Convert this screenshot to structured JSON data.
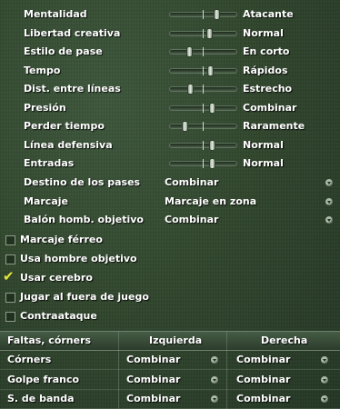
{
  "sliders": [
    {
      "label": "Mentalidad",
      "value": "Atacante",
      "level": 0.72
    },
    {
      "label": "Libertad creativa",
      "value": "Normal",
      "level": 0.6
    },
    {
      "label": "Estilo de pase",
      "value": "En corto",
      "level": 0.28
    },
    {
      "label": "Tempo",
      "value": "Rápidos",
      "level": 0.62
    },
    {
      "label": "Dist. entre líneas",
      "value": "Estrecho",
      "level": 0.3
    },
    {
      "label": "Presión",
      "value": "Combinar",
      "level": 0.64
    },
    {
      "label": "Perder tiempo",
      "value": "Raramente",
      "level": 0.2
    },
    {
      "label": "Línea defensiva",
      "value": "Normal",
      "level": 0.64
    },
    {
      "label": "Entradas",
      "value": "Normal",
      "level": 0.64
    }
  ],
  "dropdowns": [
    {
      "label": "Destino de los pases",
      "value": "Combinar"
    },
    {
      "label": "Marcaje",
      "value": "Marcaje en zona"
    },
    {
      "label": "Balón homb. objetivo",
      "value": "Combinar"
    }
  ],
  "checkboxes": [
    {
      "label": "Marcaje férreo",
      "checked": false
    },
    {
      "label": "Usa hombre objetivo",
      "checked": false
    },
    {
      "label": "Usar cerebro",
      "checked": true
    },
    {
      "label": "Jugar al fuera de juego",
      "checked": false
    },
    {
      "label": "Contraataque",
      "checked": false
    }
  ],
  "set_pieces": {
    "headers": [
      "Faltas, córners",
      "Izquierda",
      "Derecha"
    ],
    "rows": [
      {
        "label": "Córners",
        "left": "Combinar",
        "right": "Combinar"
      },
      {
        "label": "Golpe franco",
        "left": "Combinar",
        "right": "Combinar"
      },
      {
        "label": "S. de banda",
        "left": "Combinar",
        "right": "Combinar"
      }
    ]
  },
  "colors": {
    "check": "#e6e63a",
    "pitch": "#33492f"
  }
}
